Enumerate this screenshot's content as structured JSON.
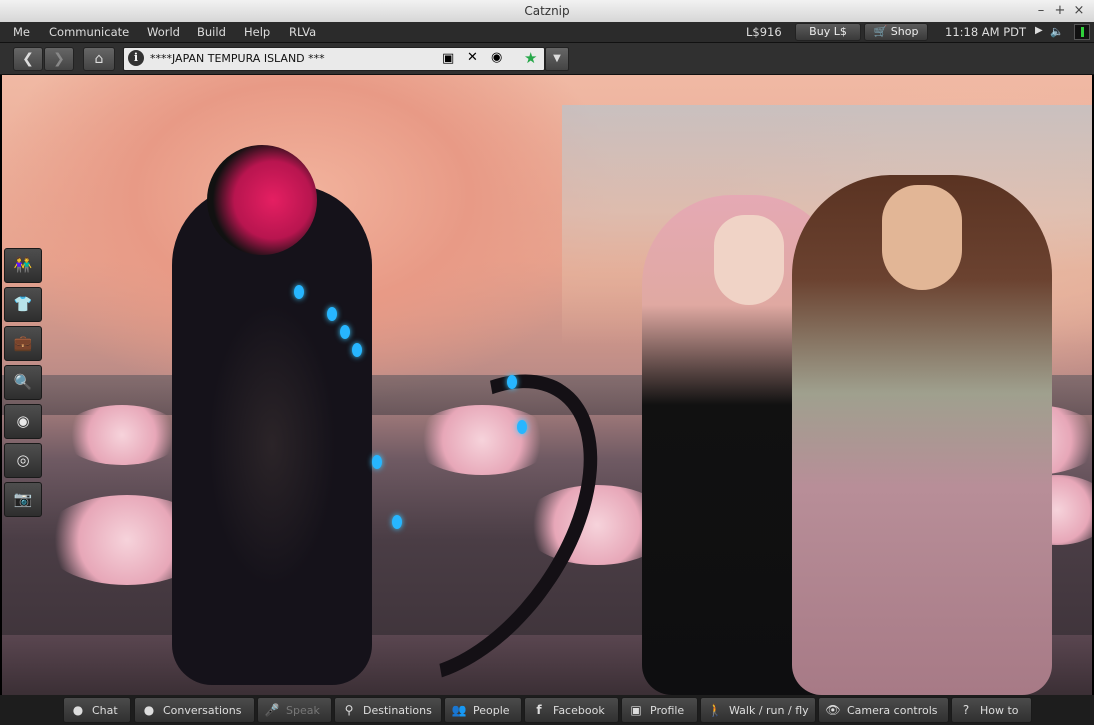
{
  "window": {
    "title": "Catznip",
    "controls": [
      "–",
      "+",
      "×"
    ]
  },
  "menubar": {
    "items": [
      "Me",
      "Communicate",
      "World",
      "Build",
      "Help",
      "RLVa"
    ],
    "balance": "L$916",
    "buy_label": "Buy L$",
    "shop_label": "Shop",
    "time": "11:18 AM PDT"
  },
  "navbar": {
    "location": "****JAPAN TEMPURA ISLAND ***",
    "icons": [
      "back-icon",
      "forward-icon",
      "home-icon",
      "info-icon",
      "no-build-icon",
      "no-fly-icon",
      "no-voice-icon",
      "favorite-star-icon",
      "dropdown-icon"
    ]
  },
  "left_toolbar": {
    "items": [
      "people-icon",
      "appearance-icon",
      "inventory-icon",
      "search-icon",
      "voice-icon",
      "radar-icon",
      "snapshot-icon"
    ]
  },
  "bottom_toolbar": {
    "buttons": [
      {
        "label": "Chat",
        "icon": "chat-icon"
      },
      {
        "label": "Conversations",
        "icon": "conversations-icon"
      },
      {
        "label": "Speak",
        "icon": "microphone-icon"
      },
      {
        "label": "Destinations",
        "icon": "map-pin-icon"
      },
      {
        "label": "People",
        "icon": "people-icon"
      },
      {
        "label": "Facebook",
        "icon": "facebook-icon"
      },
      {
        "label": "Profile",
        "icon": "profile-icon"
      },
      {
        "label": "Walk / run / fly",
        "icon": "walk-icon"
      },
      {
        "label": "Camera controls",
        "icon": "eye-icon"
      },
      {
        "label": "How to",
        "icon": "help-icon"
      }
    ]
  },
  "colors": {
    "accent_star": "#27a84a",
    "menubar_bg": "#2b2b2b",
    "toolbar_bg": "#303030"
  }
}
